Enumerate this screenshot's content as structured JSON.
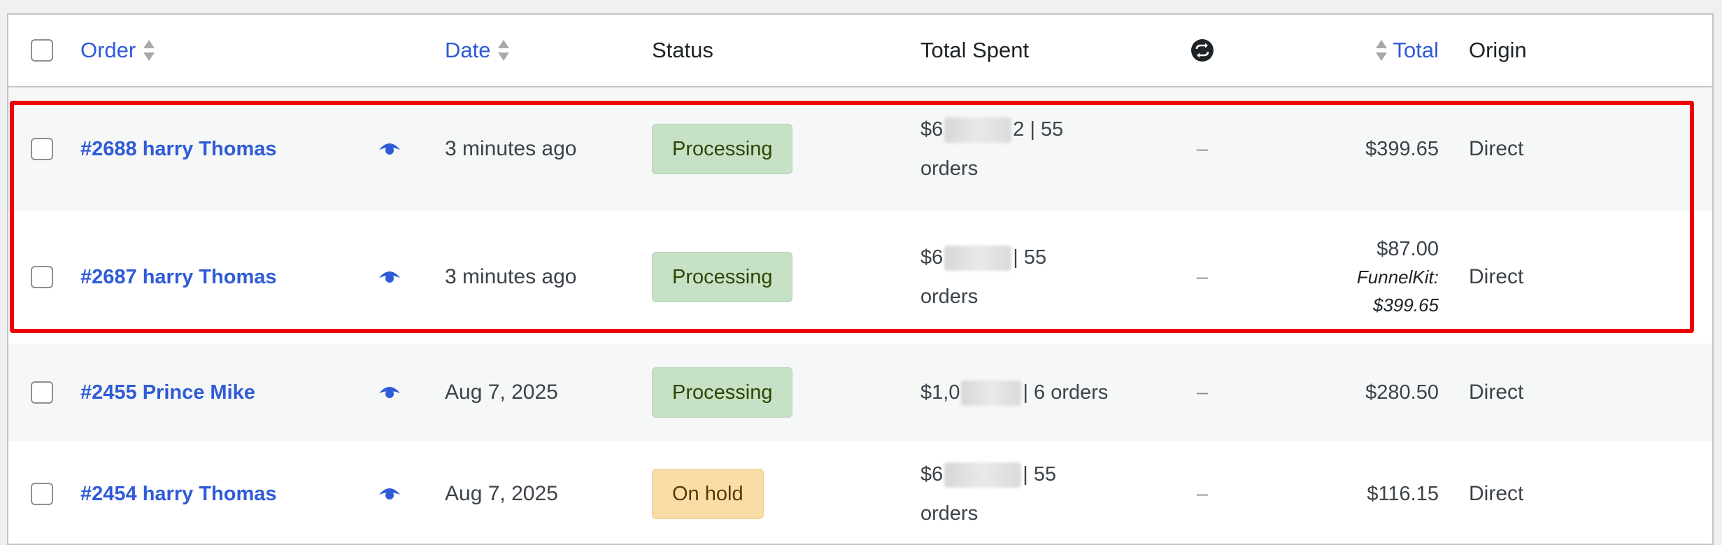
{
  "colors": {
    "link": "#2f5bd7",
    "processing_bg": "#c6e1c6",
    "processing_text": "#2c4700",
    "onhold_bg": "#f8dda7",
    "onhold_text": "#573b00",
    "highlight": "#ee0000"
  },
  "header": {
    "order": "Order",
    "date": "Date",
    "status": "Status",
    "total_spent": "Total Spent",
    "subscription_icon": "subscription-icon",
    "total": "Total",
    "origin": "Origin"
  },
  "rows": [
    {
      "order": "#2688 harry Thomas",
      "date": "3 minutes ago",
      "status": "Processing",
      "spent_prefix": "$6",
      "spent_suffix": "2 | 55",
      "spent_line2": "orders",
      "sub": "–",
      "total": "$399.65",
      "origin": "Direct"
    },
    {
      "order": "#2687 harry Thomas",
      "date": "3 minutes ago",
      "status": "Processing",
      "spent_prefix": "$6",
      "spent_suffix": "| 55",
      "spent_line2": "orders",
      "sub": "–",
      "total": "$87.00",
      "total_note_1": "FunnelKit:",
      "total_note_2": "$399.65",
      "origin": "Direct"
    },
    {
      "order": "#2455 Prince Mike",
      "date": "Aug 7, 2025",
      "status": "Processing",
      "spent_prefix": "$1,0",
      "spent_suffix": "| 6 orders",
      "sub": "–",
      "total": "$280.50",
      "origin": "Direct"
    },
    {
      "order": "#2454 harry Thomas",
      "date": "Aug 7, 2025",
      "status": "On hold",
      "spent_prefix": "$6",
      "spent_suffix": "| 55",
      "spent_line2": "orders",
      "sub": "–",
      "total": "$116.15",
      "origin": "Direct"
    }
  ]
}
